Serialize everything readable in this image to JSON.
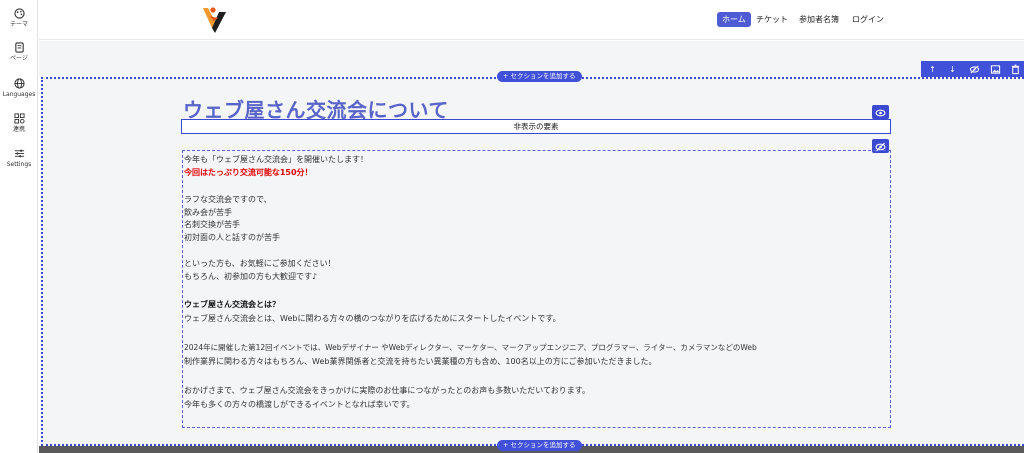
{
  "sidebar": {
    "items": [
      {
        "label": "テーマ",
        "icon": "palette-icon"
      },
      {
        "label": "ページ",
        "icon": "page-icon"
      },
      {
        "label": "Languages",
        "icon": "globe-icon"
      },
      {
        "label": "連携",
        "icon": "integration-icon"
      },
      {
        "label": "Settings",
        "icon": "sliders-icon"
      }
    ]
  },
  "header": {
    "nav": [
      {
        "label": "ホーム",
        "active": true
      },
      {
        "label": "チケット",
        "active": false
      },
      {
        "label": "参加者名簿",
        "active": false
      },
      {
        "label": "ログイン",
        "active": false
      }
    ]
  },
  "editor": {
    "add_section_label": "セクションを追加する",
    "accent": "#3b49d0",
    "toolbar_icons": [
      "arrow-up-icon",
      "arrow-down-icon",
      "visibility-off-icon",
      "image-icon",
      "delete-icon"
    ]
  },
  "main": {
    "title": "ウェブ屋さん交流会について",
    "hidden_label": "非表示の要素",
    "lines": [
      "今年も「ウェブ屋さん交流会」を開催いたします！",
      "今回はたっぷり交流可能な150分！",
      "",
      "ラフな交流会ですので、",
      "飲み会が苦手",
      "名刺交換が苦手",
      "初対面の人と話すのが苦手",
      "",
      "といった方も、お気軽にご参加ください！",
      "もちろん、初参加の方も大歓迎です♪",
      "",
      "ウェブ屋さん交流会とは？",
      "ウェブ屋さん交流会とは、Webに関わる方々の横のつながりを広げるためにスタートしたイベントです。",
      "",
      "2024年に開催した第12回イベントでは、Webデザイナー やWebディレクター、マーケター、マークアップエンジニア、プログラマー、ライター、カメラマンなどのWeb",
      "制作業界に関わる方々はもちろん、Web業界関係者と交流を持ちたい異業種の方も含め、100名以上の方にご参加いただきました。",
      "",
      "おかげさまで、ウェブ屋さん交流会をきっかけに実際のお仕事につながったとのお声も多数いただいております。",
      "今年も多くの方々の橋渡しができるイベントとなれば幸いです。"
    ]
  }
}
